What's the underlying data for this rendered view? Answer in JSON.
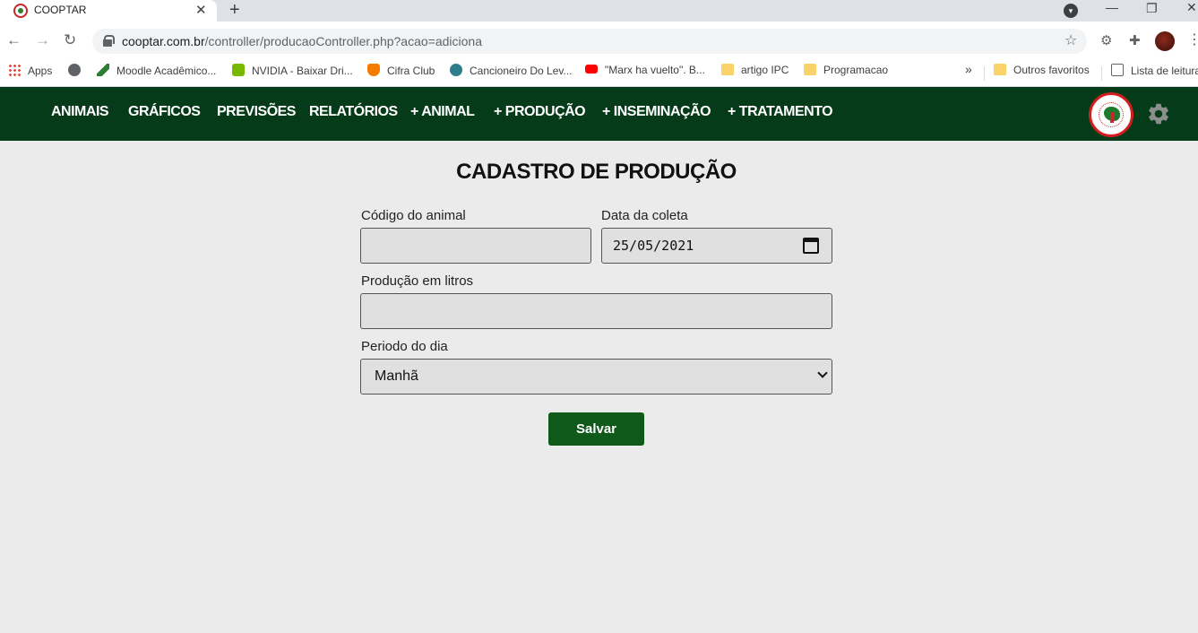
{
  "browser": {
    "tab_title": "COOPTAR",
    "url_host": "cooptar.com.br",
    "url_path": "/controller/producaoController.php?acao=adiciona",
    "bookmarks": [
      {
        "label": "Apps",
        "icon": "apps-icon"
      },
      {
        "label": "",
        "icon": "globe-icon"
      },
      {
        "label": "Moodle Acadêmico...",
        "icon": "moodle-icon"
      },
      {
        "label": "NVIDIA - Baixar Dri...",
        "icon": "nvidia-icon"
      },
      {
        "label": "Cifra Club",
        "icon": "cifra-club-icon"
      },
      {
        "label": "Cancioneiro Do Lev...",
        "icon": "cancioneiro-icon"
      },
      {
        "label": "\"Marx ha vuelto\". B...",
        "icon": "youtube-icon"
      },
      {
        "label": "artigo IPC",
        "icon": "folder-icon"
      },
      {
        "label": "Programacao",
        "icon": "folder-icon"
      }
    ],
    "overflow_label": "»",
    "other_bookmarks": "Outros favoritos",
    "reading_list": "Lista de leitura"
  },
  "navbar": {
    "links": [
      "ANIMAIS",
      "GRÁFICOS",
      "PREVISÕES",
      "RELATÓRIOS",
      "+ ANIMAL",
      "+ PRODUÇÃO",
      "+ INSEMINAÇÃO",
      "+ TRATAMENTO"
    ]
  },
  "form": {
    "title": "CADASTRO DE PRODUÇÃO",
    "animal_code_label": "Código do animal",
    "animal_code_value": "",
    "date_label": "Data da coleta",
    "date_value": "25/05/2021",
    "liters_label": "Produção em litros",
    "liters_value": "",
    "period_label": "Periodo do dia",
    "period_value": "Manhã",
    "save_label": "Salvar"
  },
  "colors": {
    "navbar_bg": "#063b19",
    "button_bg": "#0f5a1b",
    "page_bg": "#ebebeb",
    "field_bg": "#e0e0e0"
  }
}
